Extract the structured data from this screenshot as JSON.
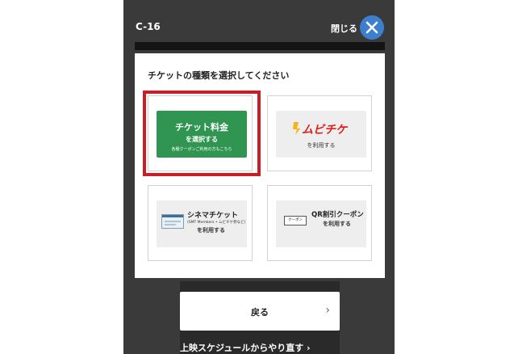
{
  "header": {
    "seat_code": "C-16",
    "close_label": "閉じる",
    "close_icon": "close-icon"
  },
  "modal": {
    "title": "チケットの種類を選択してください",
    "options": [
      {
        "line1": "チケット料金",
        "line2": "を選択する",
        "line3": "各種クーポンご利用の方もこちら"
      },
      {
        "logo_text": "ムビチケ",
        "sub": "を利用する"
      },
      {
        "title": "シネマチケット",
        "small": "(SMT Members • ムビチケ券など)",
        "use": "を利用する",
        "icon": "ticket-icon"
      },
      {
        "title": "QR割引クーポン",
        "use": "を利用する",
        "icon_text": "クーポン"
      }
    ]
  },
  "footer": {
    "back_label": "戻る",
    "back_chevron": "›",
    "redo_link": "上映スケジュールからやり直す ›"
  },
  "colors": {
    "green": "#2f9550",
    "highlight": "#c71f25",
    "close_button": "#3d7fcf",
    "mubi_red": "#e1211e",
    "mubi_yellow": "#f6b416"
  }
}
